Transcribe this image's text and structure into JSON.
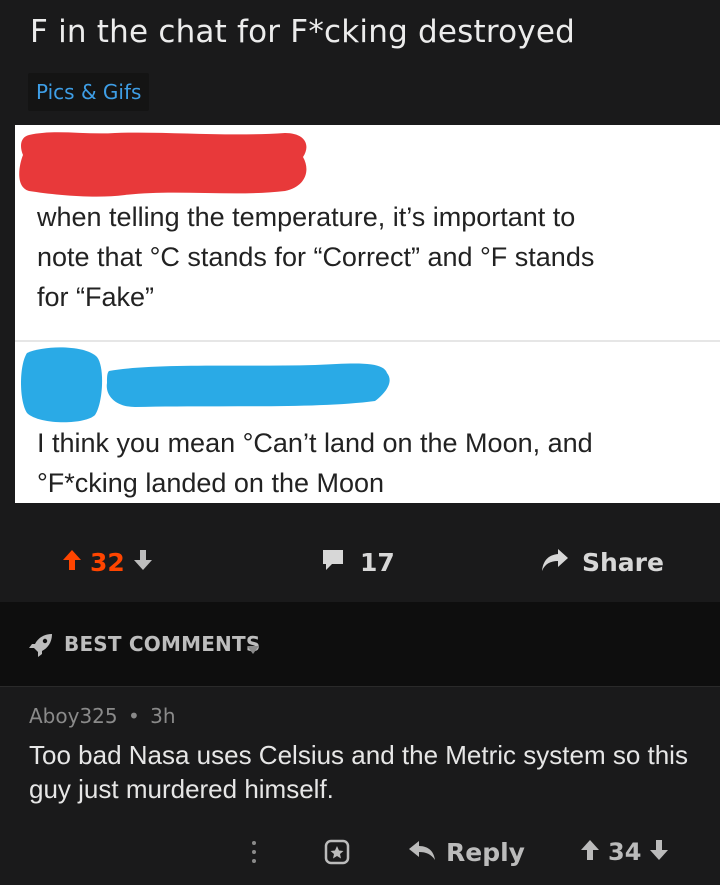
{
  "post": {
    "title": "F in the chat for F*cking destroyed",
    "flair": "Pics & Gifs",
    "image": {
      "tweet1_lines": [
        "when telling the temperature, it’s important to",
        "note that °C stands for “Correct” and °F stands",
        "for “Fake”"
      ],
      "tweet2_lines": [
        "I think you mean °Can’t land on the Moon, and",
        "°F*cking landed on the Moon"
      ],
      "redaction_colors": {
        "top": "#e8393a",
        "bottom": "#2aaae6"
      }
    },
    "score": "32",
    "comments_count": "17",
    "share_label": "Share"
  },
  "colors": {
    "upvote_active": "#ff4500",
    "flair_text": "#3e9ee6",
    "background": "#1a1a1b"
  },
  "comments_section": {
    "sort_label": "BEST COMMENTS",
    "comments": [
      {
        "author": "Aboy325",
        "separator": "•",
        "age": "3h",
        "body": "Too bad Nasa uses Celsius and the Metric system so this guy just murdered himself.",
        "reply_label": "Reply",
        "score": "34"
      }
    ]
  }
}
